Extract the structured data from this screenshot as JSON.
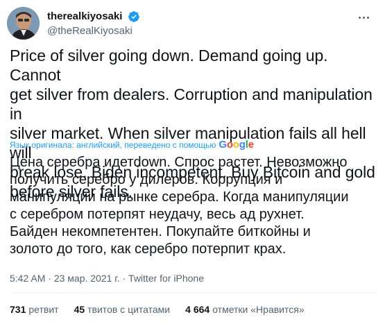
{
  "author": {
    "display_name": "therealkiyosaki",
    "handle": "@theRealKiyosaki"
  },
  "tweet": {
    "text_original": "Price of silver going down. Demand going up. Cannot\nget silver from dealers. Corruption and manipulation in\nsilver market. When silver manipulation fails all hell will\nbreak lose. Biden incompetent. Buy Bitcoin and gold\nbefore silver fails.",
    "translation_note": "Язык оригинала: английский, переведено с помощью",
    "translation_provider": "Google",
    "text_translated": "Цена серебра идетdown. Спрос растет. Невозможно\nполучить серебро у дилеров. Коррупция и\nманипуляции на рынке серебра. Когда манипуляции\nс серебром потерпят неудачу, весь ад рухнет.\nБайден некомпетентен. Покупайте биткойны и\nзолото до того, как серебро потерпит крах.",
    "time": "5:42 AM",
    "date": "23 мар. 2021 г.",
    "separator": "·",
    "source": "Twitter for iPhone"
  },
  "stats": {
    "retweets_count": "731",
    "retweets_label": "ретвит",
    "quotes_count": "45",
    "quotes_label": "твитов с цитатами",
    "likes_count": "4 664",
    "likes_label": "отметки «Нравится»"
  },
  "colors": {
    "link_blue": "#1d9bf0",
    "secondary_text": "#536471",
    "verified_blue": "#1d9bf0"
  },
  "icons": {
    "verified": "verified-badge-icon",
    "more": "more-options-icon"
  }
}
